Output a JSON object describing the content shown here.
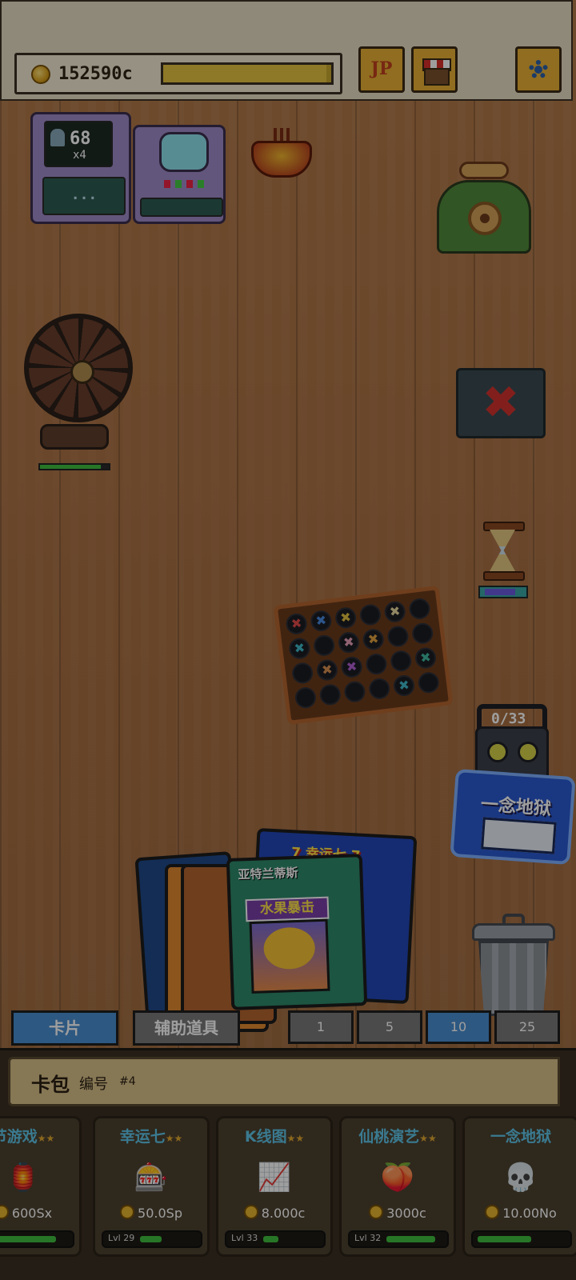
{
  "header": {
    "coins": "152590c",
    "progress": 0.97,
    "jp_label": "JP"
  },
  "table": {
    "monitor": {
      "count": "68",
      "multiplier": "x4",
      "display": "..."
    },
    "robot_counter": "0/33",
    "hell_card_title": "一念地狱",
    "fruit_card_title": "亚特兰蒂斯",
    "fruit_card_subtitle": "水果暴击",
    "lucky_card_title": "7 幸运七 7",
    "fan_health": 0.88
  },
  "board": {
    "cells": [
      {
        "glyph": "✖",
        "color": "#e04a4a"
      },
      {
        "glyph": "✖",
        "color": "#4a8ae0"
      },
      {
        "glyph": "✖",
        "color": "#e0c040"
      },
      {
        "glyph": "",
        "color": ""
      },
      {
        "glyph": "✖",
        "color": "#e8d8a0"
      },
      {
        "glyph": "",
        "color": ""
      },
      {
        "glyph": "✖",
        "color": "#3fb8c8"
      },
      {
        "glyph": "",
        "color": ""
      },
      {
        "glyph": "✖",
        "color": "#e8a0b8"
      },
      {
        "glyph": "✖",
        "color": "#e0a040"
      },
      {
        "glyph": "",
        "color": ""
      },
      {
        "glyph": "",
        "color": ""
      },
      {
        "glyph": "",
        "color": ""
      },
      {
        "glyph": "✖",
        "color": "#d89050"
      },
      {
        "glyph": "✖",
        "color": "#b060d0"
      },
      {
        "glyph": "",
        "color": ""
      },
      {
        "glyph": "",
        "color": ""
      },
      {
        "glyph": "✖",
        "color": "#3fb8a0"
      },
      {
        "glyph": "",
        "color": ""
      },
      {
        "glyph": "",
        "color": ""
      },
      {
        "glyph": "",
        "color": ""
      },
      {
        "glyph": "",
        "color": ""
      },
      {
        "glyph": "✖",
        "color": "#3fb8c8"
      },
      {
        "glyph": "",
        "color": ""
      }
    ]
  },
  "tabs": {
    "cards": "卡片",
    "tools": "辅助道具",
    "qty": [
      "1",
      "5",
      "10",
      "25"
    ],
    "selected_qty": "10"
  },
  "pack": {
    "title": "卡包",
    "number_label": "编号",
    "number": "#4",
    "items": [
      {
        "name": "节游戏",
        "stars": "★★",
        "icon": "🏮",
        "price": "600Sx",
        "level": "",
        "fill": 0.85
      },
      {
        "name": "幸运七",
        "stars": "★★",
        "icon": "🎰",
        "price": "50.0Sp",
        "level": "Lvl 29",
        "fill": 0.35
      },
      {
        "name": "K线图",
        "stars": "★★",
        "icon": "📈",
        "price": "8.000c",
        "level": "Lvl 33",
        "fill": 0.25
      },
      {
        "name": "仙桃演艺",
        "stars": "★★",
        "icon": "🍑",
        "price": "3000c",
        "level": "Lvl 32",
        "fill": 0.8
      },
      {
        "name": "一念地狱",
        "stars": "",
        "icon": "💀",
        "price": "10.00No",
        "level": "",
        "fill": 0.6
      }
    ]
  },
  "colors": {
    "selected_tab": "#4a8fd0",
    "unselected_tab": "#7a7a7a",
    "accent_gold": "#e5b52f",
    "wood": "#a86f42"
  }
}
